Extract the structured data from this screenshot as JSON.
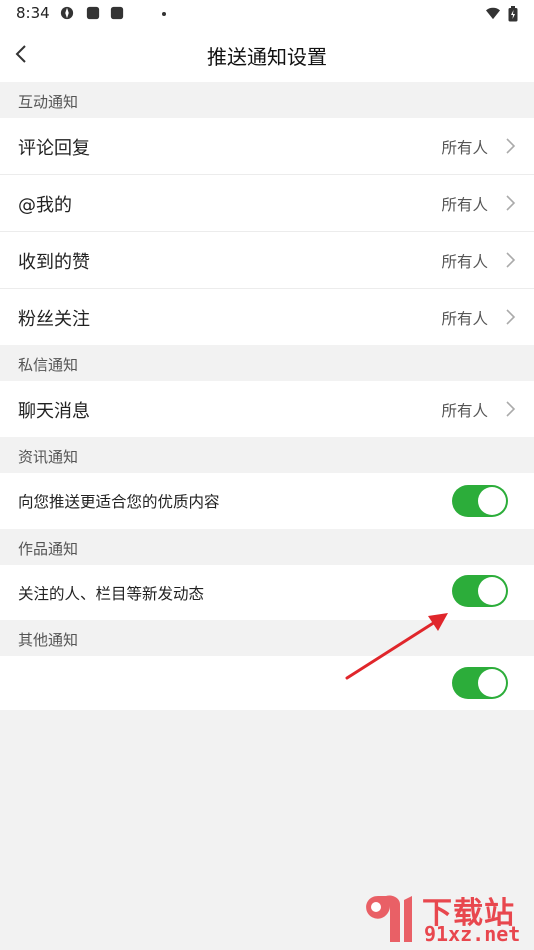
{
  "status_bar": {
    "time": "8:34"
  },
  "header": {
    "title": "推送通知设置"
  },
  "sections": [
    {
      "title": "互动通知",
      "rows": [
        {
          "label": "评论回复",
          "value": "所有人"
        },
        {
          "label": "@我的",
          "value": "所有人"
        },
        {
          "label": "收到的赞",
          "value": "所有人"
        },
        {
          "label": "粉丝关注",
          "value": "所有人"
        }
      ]
    },
    {
      "title": "私信通知",
      "rows": [
        {
          "label": "聊天消息",
          "value": "所有人"
        }
      ]
    },
    {
      "title": "资讯通知",
      "toggle_rows": [
        {
          "label": "向您推送更适合您的优质内容",
          "on": true
        }
      ]
    },
    {
      "title": "作品通知",
      "toggle_rows": [
        {
          "label": "关注的人、栏目等新发动态",
          "on": true
        }
      ]
    },
    {
      "title": "其他通知",
      "toggle_rows": [
        {
          "label": "",
          "on": true
        }
      ]
    }
  ],
  "watermark": {
    "line1": "下载站",
    "line2": "91xz.net"
  },
  "colors": {
    "toggle_on": "#2cad3a",
    "annotation_arrow": "#e0262b",
    "watermark": "#e8474e"
  }
}
